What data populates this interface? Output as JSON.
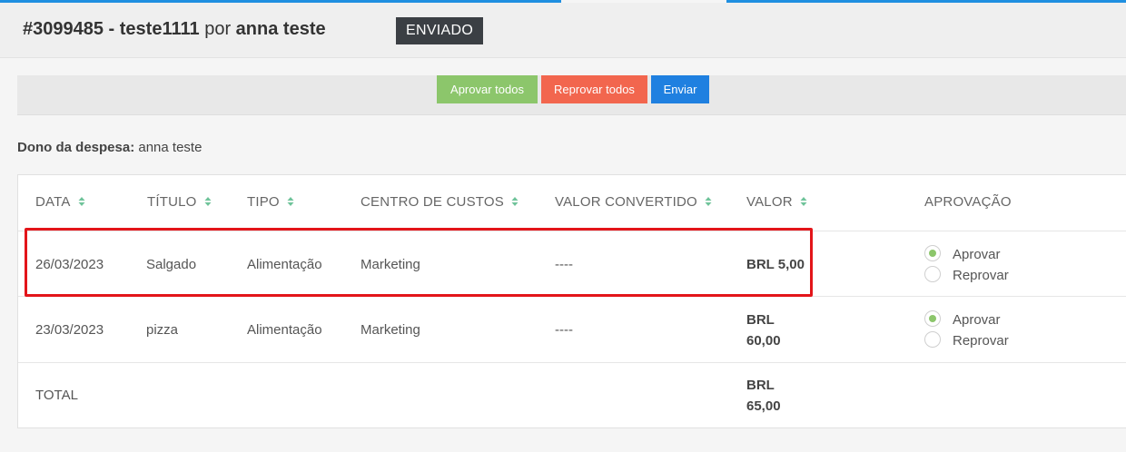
{
  "header": {
    "id_title": "#3099485 - teste1111",
    "por": "por",
    "author": "anna teste",
    "status": "ENVIADO"
  },
  "toolbar": {
    "approve_all": "Aprovar todos",
    "reject_all": "Reprovar todos",
    "send": "Enviar"
  },
  "owner": {
    "label": "Dono da despesa:",
    "name": "anna teste"
  },
  "table": {
    "columns": [
      "DATA",
      "TÍTULO",
      "TIPO",
      "CENTRO DE CUSTOS",
      "VALOR CONVERTIDO",
      "VALOR",
      "APROVAÇÃO"
    ],
    "rows": [
      {
        "date": "26/03/2023",
        "title": "Salgado",
        "type": "Alimentação",
        "cost_center": "Marketing",
        "converted": "----",
        "value": "BRL 5,00",
        "approve": "Aprovar",
        "reject": "Reprovar",
        "selected": "approve"
      },
      {
        "date": "23/03/2023",
        "title": "pizza",
        "type": "Alimentação",
        "cost_center": "Marketing",
        "converted": "----",
        "value_line1": "BRL",
        "value_line2": "60,00",
        "approve": "Aprovar",
        "reject": "Reprovar",
        "selected": "approve"
      }
    ],
    "total": {
      "label": "TOTAL",
      "value_line1": "BRL",
      "value_line2": "65,00"
    }
  },
  "colors": {
    "approve": "#8cc66b",
    "reject": "#f2664e",
    "send": "#1f80e0",
    "status_badge": "#3b3f44",
    "highlight": "#e3151a",
    "sort_icon": "#6fc39a"
  }
}
